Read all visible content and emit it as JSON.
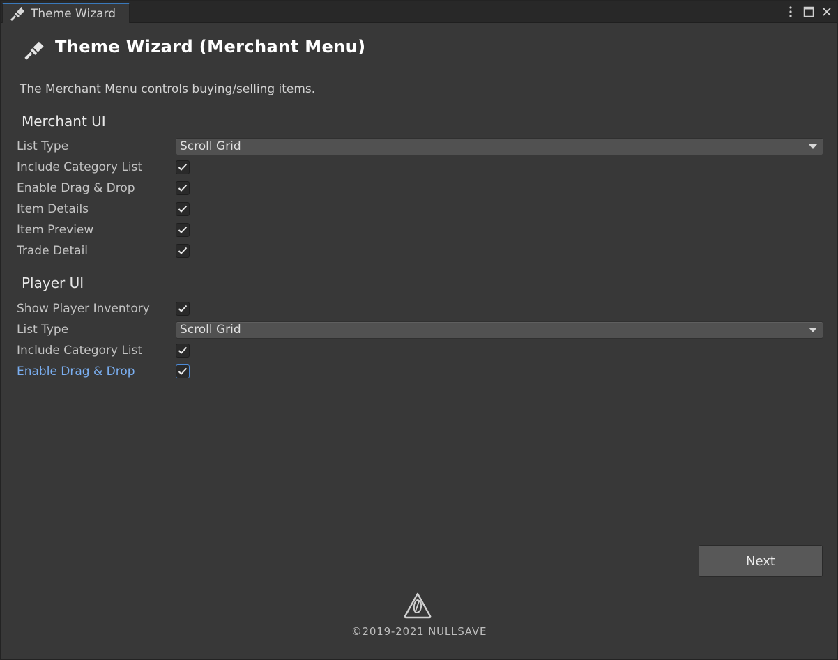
{
  "tab": {
    "title": "Theme Wizard"
  },
  "window_controls": [
    "more-vert-icon",
    "maximize-icon",
    "close-icon"
  ],
  "header": {
    "title": "Theme Wizard (Merchant Menu)"
  },
  "description": "The Merchant Menu controls buying/selling items.",
  "merchant_ui": {
    "title": "Merchant UI",
    "list_type_label": "List Type",
    "list_type_value": "Scroll Grid",
    "options": [
      {
        "label": "Include Category List",
        "checked": true
      },
      {
        "label": "Enable Drag & Drop",
        "checked": true
      },
      {
        "label": "Item Details",
        "checked": true
      },
      {
        "label": "Item Preview",
        "checked": true
      },
      {
        "label": "Trade Detail",
        "checked": true
      }
    ]
  },
  "player_ui": {
    "title": "Player UI",
    "show_inventory_label": "Show Player Inventory",
    "show_inventory_checked": true,
    "list_type_label": "List Type",
    "list_type_value": "Scroll Grid",
    "include_category_label": "Include Category List",
    "include_category_checked": true,
    "drag_drop_label": "Enable Drag & Drop",
    "drag_drop_checked": true
  },
  "next_button": "Next",
  "footer": {
    "copyright": "©2019-2021 NULLSAVE"
  },
  "colors": {
    "accent": "#3a79bb",
    "active_label": "#7aaef0",
    "panel": "#383838"
  }
}
